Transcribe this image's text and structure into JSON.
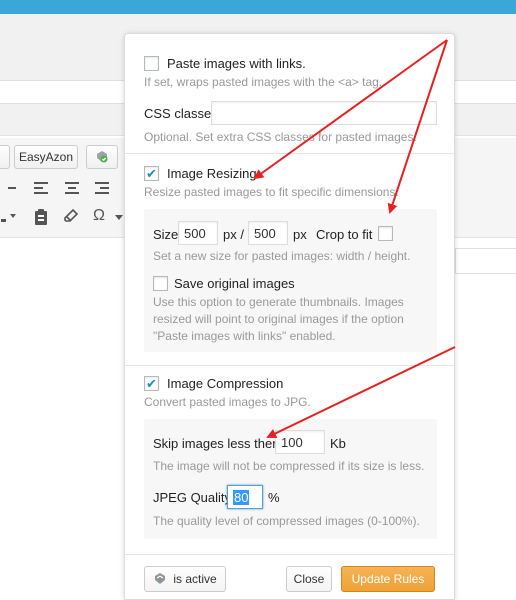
{
  "editor": {
    "easyazon_label": "EasyAzon",
    "omega_glyph": "Ω"
  },
  "paste_links": {
    "label": "Paste images with links.",
    "hint": "If set, wraps pasted images with the <a> tag.",
    "checked": false
  },
  "css_classes": {
    "label": "CSS classes",
    "value": "",
    "hint": "Optional. Set extra CSS classes for pasted images."
  },
  "resizing": {
    "label": "Image Resizing",
    "checked": true,
    "hint": "Resize pasted images to fit specific dimensions.",
    "size_label": "Size",
    "width": "500",
    "px1": "px /",
    "height": "500",
    "px2": "px",
    "crop_label": "Crop to fit",
    "crop_checked": false,
    "size_hint": "Set a new size for pasted images: width / height.",
    "save_original_label": "Save original images",
    "save_original_checked": false,
    "save_original_hint": "Use this option to generate thumbnails. Images resized will point to original images if the option \"Paste images with links\" enabled."
  },
  "compression": {
    "label": "Image Compression",
    "checked": true,
    "hint": "Convert pasted images to JPG.",
    "skip_label": "Skip images less then",
    "skip_value": "100",
    "skip_unit": "Kb",
    "skip_hint": "The image will not be compressed if its size is less.",
    "quality_label": "JPEG Quality",
    "quality_value": "80",
    "quality_unit": "%",
    "quality_hint": "The quality level of compressed images (0-100%)."
  },
  "footer": {
    "active_label": "is active",
    "close_label": "Close",
    "update_label": "Update Rules"
  },
  "colors": {
    "accent": "#1e8cbe",
    "primary_button": "#eea236",
    "annotation_arrow": "#e8201f"
  }
}
